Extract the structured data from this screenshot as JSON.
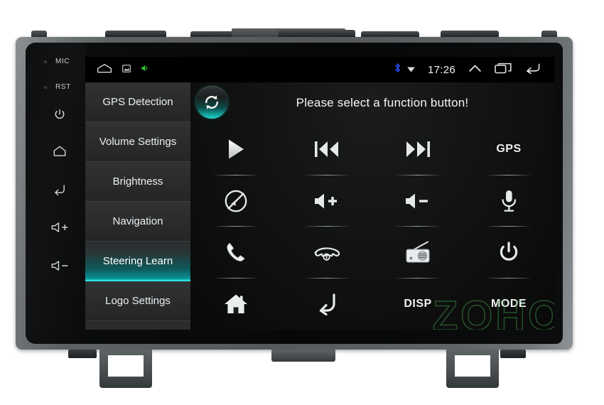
{
  "device": {
    "brand_watermark": "ZOHONG",
    "hardkeys": [
      {
        "name": "mic",
        "label": "MIC",
        "type": "text"
      },
      {
        "name": "reset",
        "label": "RST",
        "type": "text"
      },
      {
        "name": "power",
        "label": "power-icon",
        "type": "icon"
      },
      {
        "name": "home",
        "label": "home-icon",
        "type": "icon"
      },
      {
        "name": "back",
        "label": "back-icon",
        "type": "icon"
      },
      {
        "name": "volume-up",
        "label": "volume-up-icon",
        "type": "icon"
      },
      {
        "name": "volume-down",
        "label": "volume-down-icon",
        "type": "icon"
      }
    ]
  },
  "statusbar": {
    "time": "17:26",
    "left_icons": [
      "home-icon",
      "screenshot-icon",
      "volume-icon"
    ],
    "right_icons": [
      "bluetooth-icon",
      "dropdown-triangle-icon",
      "chevron-up-icon",
      "recent-apps-icon",
      "back-arrow-icon"
    ],
    "bluetooth_color": "#2b49e8",
    "volume_icon_color": "#31c234"
  },
  "sidebar": {
    "items": [
      {
        "label": "GPS Detection",
        "active": false
      },
      {
        "label": "Volume Settings",
        "active": false
      },
      {
        "label": "Brightness",
        "active": false
      },
      {
        "label": "Navigation",
        "active": false
      },
      {
        "label": "Steering Learn",
        "active": true
      },
      {
        "label": "Logo Settings",
        "active": false
      }
    ],
    "active_accent": "#2ee0e3"
  },
  "panel": {
    "title": "Please select a function button!",
    "refresh_button": "refresh-icon",
    "refresh_accent": "#2bd6cc",
    "grid": [
      {
        "name": "play",
        "kind": "icon",
        "label": "play-icon"
      },
      {
        "name": "previous",
        "kind": "icon",
        "label": "previous-track-icon"
      },
      {
        "name": "next",
        "kind": "icon",
        "label": "next-track-icon"
      },
      {
        "name": "gps",
        "kind": "text",
        "label": "GPS"
      },
      {
        "name": "mute",
        "kind": "icon",
        "label": "mute-icon"
      },
      {
        "name": "volume-up",
        "kind": "icon",
        "label": "volume-up-icon"
      },
      {
        "name": "volume-down",
        "kind": "icon",
        "label": "volume-down-icon"
      },
      {
        "name": "voice",
        "kind": "icon",
        "label": "microphone-icon"
      },
      {
        "name": "call",
        "kind": "icon",
        "label": "phone-call-icon"
      },
      {
        "name": "hangup",
        "kind": "icon",
        "label": "phone-hangup-icon"
      },
      {
        "name": "radio",
        "kind": "icon",
        "label": "radio-icon"
      },
      {
        "name": "power",
        "kind": "icon",
        "label": "power-icon"
      },
      {
        "name": "home",
        "kind": "icon",
        "label": "home-icon"
      },
      {
        "name": "back",
        "kind": "icon",
        "label": "back-icon"
      },
      {
        "name": "disp",
        "kind": "text",
        "label": "DISP"
      },
      {
        "name": "mode",
        "kind": "text",
        "label": "MODE"
      }
    ]
  }
}
